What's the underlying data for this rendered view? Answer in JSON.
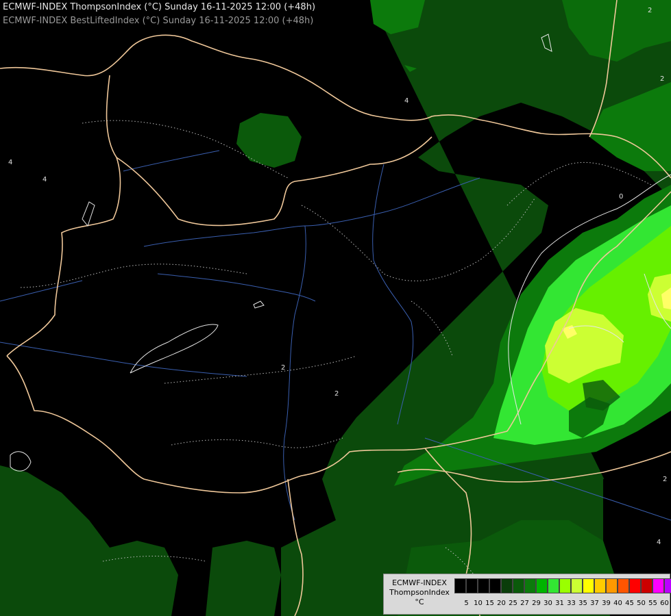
{
  "titles": {
    "line1": "ECMWF-INDEX ThompsonIndex (°C) Sunday 16-11-2025 12:00 (+48h)",
    "line2": "ECMWF-INDEX BestLiftedIndex (°C) Sunday 16-11-2025 12:00 (+48h)"
  },
  "legend": {
    "model": "ECMWF-INDEX",
    "parameter": "ThompsonIndex",
    "unit": "°C",
    "ticks": [
      "5",
      "10",
      "15",
      "20",
      "25",
      "27",
      "29",
      "30",
      "31",
      "33",
      "35",
      "37",
      "39",
      "40",
      "45",
      "50",
      "55",
      "60"
    ],
    "colors": [
      "#000000",
      "#000000",
      "#000000",
      "#000000",
      "#0a3d0a",
      "#0b5a0b",
      "#0c7a0c",
      "#00b400",
      "#33e633",
      "#9aff00",
      "#ccff33",
      "#ffff00",
      "#ffcc00",
      "#ff9900",
      "#ff5500",
      "#ff0000",
      "#cc0000",
      "#ff00ff",
      "#bb00ff",
      "#7700ff",
      "#0000ff"
    ]
  },
  "contour_labels": [
    {
      "text": "4"
    },
    {
      "text": "4"
    },
    {
      "text": "4"
    },
    {
      "text": "2"
    },
    {
      "text": "2"
    },
    {
      "text": "2"
    },
    {
      "text": "0"
    },
    {
      "text": "2"
    },
    {
      "text": "2"
    },
    {
      "text": "4"
    }
  ]
}
